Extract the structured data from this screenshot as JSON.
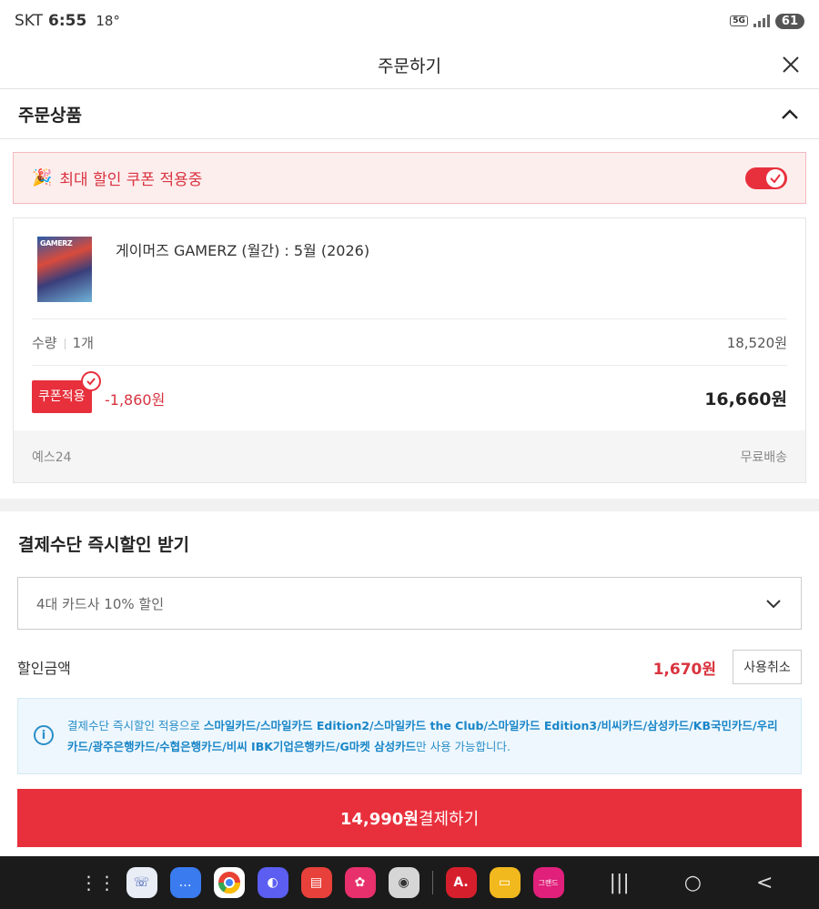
{
  "status_bar": {
    "carrier": "SKT",
    "time": "6:55",
    "temp": "18°",
    "network": "5G",
    "battery": "61"
  },
  "header": {
    "title": "주문하기"
  },
  "order_section": {
    "title": "주문상품"
  },
  "coupon_banner": {
    "emoji": "🎉",
    "text": "최대 할인 쿠폰 적용중",
    "toggle_on": true
  },
  "product": {
    "title": "게이머즈 GAMERZ (월간) : 5월 (2026)",
    "thumb_logo": "GAMERZ",
    "qty_label": "수량",
    "qty_value": "1개",
    "price": "18,520원",
    "coupon_label": "쿠폰적용",
    "discount": "-1,860원",
    "final_price": "16,660원",
    "seller": "예스24",
    "shipping": "무료배송"
  },
  "payment": {
    "title": "결제수단 즉시할인 받기",
    "select_value": "4대 카드사 10% 할인",
    "discount_label": "할인금액",
    "discount_amount": "1,670원",
    "cancel_label": "사용취소",
    "info_prefix": "결제수단 즉시할인 적용으로 ",
    "info_cards": "스마일카드/스마일카드 Edition2/스마일카드 the Club/스마일카드 Edition3/비씨카드/삼성카드/KB국민카드/우리카드/광주은행카드/수협은행카드/비씨 IBK기업은행카드/G마켓 삼성카드",
    "info_suffix": "만 사용 가능합니다."
  },
  "pay_button": {
    "amount": "14,990원",
    "label": " 결제하기"
  },
  "dock": {
    "apps": [
      "apps-grid-icon",
      "phone-icon",
      "messages-icon",
      "chrome-icon",
      "internet-icon",
      "notes-icon",
      "gallery-icon",
      "camera-icon",
      "yes24-icon",
      "files-icon",
      "grand-mall-icon"
    ],
    "yes24_text": "A.",
    "grand_text": "그랜드"
  },
  "colors": {
    "accent": "#e8303c",
    "info": "#2a8ec8"
  }
}
